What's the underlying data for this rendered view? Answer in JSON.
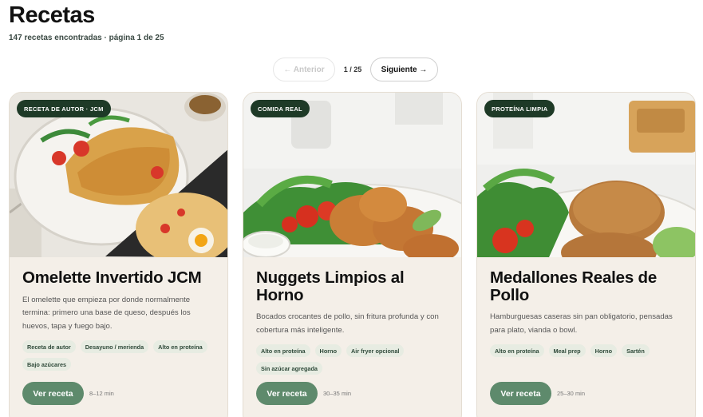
{
  "header": {
    "title": "Recetas",
    "subtitle": "147 recetas encontradas · página 1 de 25"
  },
  "pagination": {
    "prev_label": "← Anterior",
    "page_indicator": "1 / 25",
    "next_label": "Siguiente →"
  },
  "recipes": [
    {
      "badge": "RECETA DE AUTOR · JCM",
      "title": "Omelette Invertido JCM",
      "description": "El omelette que empieza por donde normalmente termina: primero una base de queso, después los huevos, tapa y fuego bajo.",
      "tags": [
        "Receta de autor",
        "Desayuno / merienda",
        "Alto en proteína",
        "Bajo azúcares"
      ],
      "button": "Ver receta",
      "time": "8–12 min"
    },
    {
      "badge": "COMIDA REAL",
      "title": "Nuggets Limpios al Horno",
      "description": "Bocados crocantes de pollo, sin fritura profunda y con cobertura más inteligente.",
      "tags": [
        "Alto en proteína",
        "Horno",
        "Air fryer opcional",
        "Sin azúcar agregada"
      ],
      "button": "Ver receta",
      "time": "30–35 min"
    },
    {
      "badge": "PROTEÍNA LIMPIA",
      "title": "Medallones Reales de Pollo",
      "description": "Hamburguesas caseras sin pan obligatorio, pensadas para plato, vianda o bowl.",
      "tags": [
        "Alto en proteína",
        "Meal prep",
        "Horno",
        "Sartén"
      ],
      "button": "Ver receta",
      "time": "25–30 min"
    }
  ],
  "colors": {
    "badge_bg": "#1e3a27",
    "button_bg": "#5e8a6c",
    "card_bg": "#f4efe8",
    "tag_bg": "#e7ece2"
  }
}
